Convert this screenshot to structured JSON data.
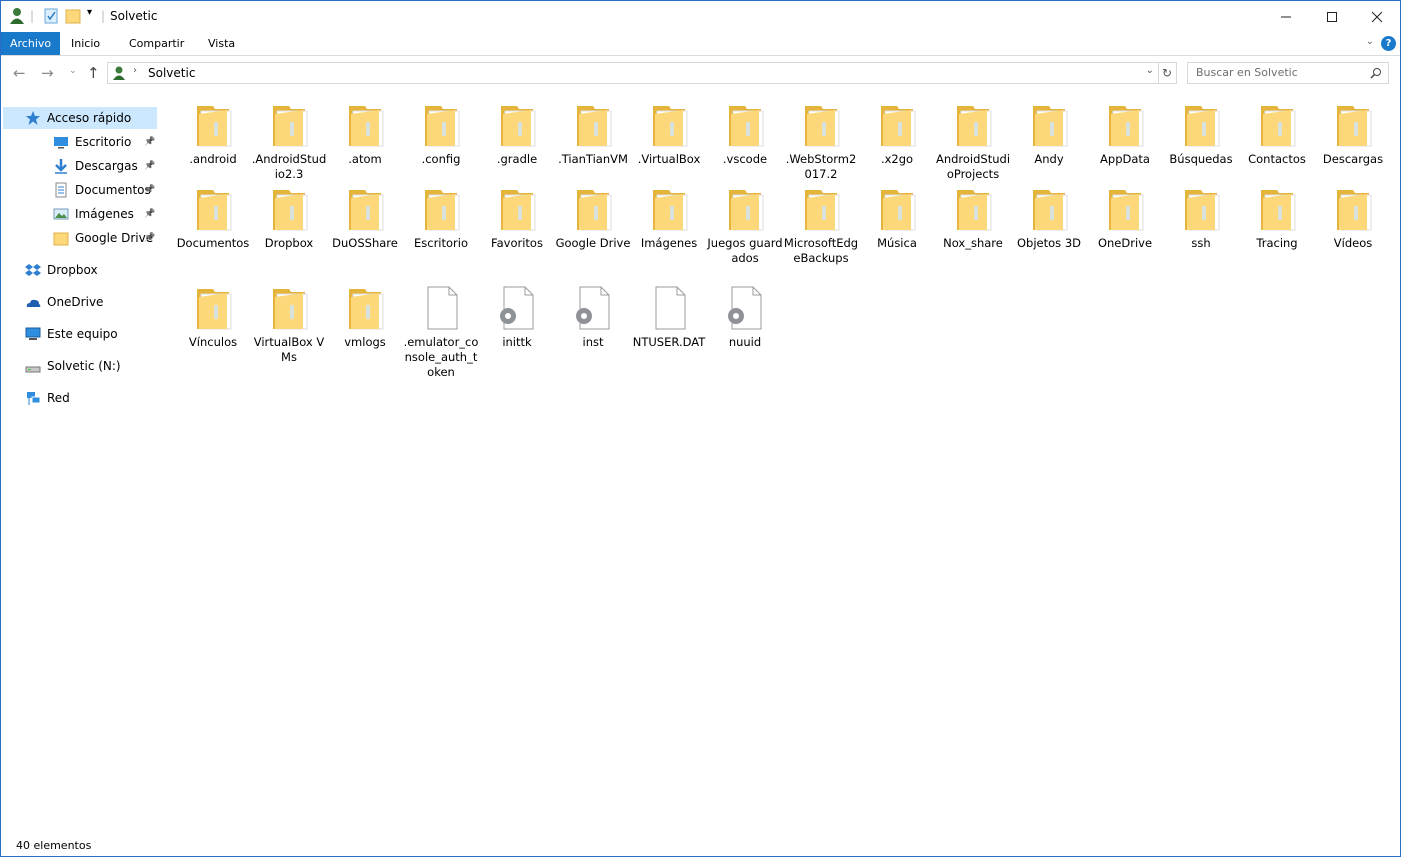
{
  "window": {
    "title": "Solvetic",
    "minimize_icon": "minimize-icon",
    "maximize_icon": "maximize-icon",
    "close_icon": "close-icon"
  },
  "ribbon": {
    "tabs": [
      "Archivo",
      "Inicio",
      "Compartir",
      "Vista"
    ],
    "active_tab": "Archivo",
    "help_label": "?"
  },
  "navigation": {
    "path": [
      "Solvetic"
    ],
    "search_placeholder": "Buscar en Solvetic"
  },
  "sidebar": {
    "items": [
      {
        "label": "Acceso rápido",
        "icon": "star-icon",
        "selected": true,
        "pinned": false
      },
      {
        "label": "Escritorio",
        "icon": "desktop-icon",
        "pinned": true
      },
      {
        "label": "Descargas",
        "icon": "download-icon",
        "pinned": true
      },
      {
        "label": "Documentos",
        "icon": "document-icon",
        "pinned": true
      },
      {
        "label": "Imágenes",
        "icon": "pictures-icon",
        "pinned": true
      },
      {
        "label": "Google Drive",
        "icon": "folder-icon",
        "pinned": true
      },
      {
        "label": "Dropbox",
        "icon": "dropbox-icon"
      },
      {
        "label": "OneDrive",
        "icon": "onedrive-icon"
      },
      {
        "label": "Este equipo",
        "icon": "computer-icon"
      },
      {
        "label": "Solvetic (N:)",
        "icon": "drive-icon"
      },
      {
        "label": "Red",
        "icon": "network-icon"
      }
    ]
  },
  "files": [
    {
      "name": ".android",
      "type": "folder"
    },
    {
      "name": ".AndroidStudio2.3",
      "type": "folder"
    },
    {
      "name": ".atom",
      "type": "folder"
    },
    {
      "name": ".config",
      "type": "folder"
    },
    {
      "name": ".gradle",
      "type": "folder"
    },
    {
      "name": ".TianTianVM",
      "type": "folder"
    },
    {
      "name": ".VirtualBox",
      "type": "folder"
    },
    {
      "name": ".vscode",
      "type": "folder"
    },
    {
      "name": ".WebStorm2017.2",
      "type": "folder"
    },
    {
      "name": ".x2go",
      "type": "folder"
    },
    {
      "name": "AndroidStudioProjects",
      "type": "folder"
    },
    {
      "name": "Andy",
      "type": "folder"
    },
    {
      "name": "AppData",
      "type": "folder"
    },
    {
      "name": "Búsquedas",
      "type": "folder"
    },
    {
      "name": "Contactos",
      "type": "folder"
    },
    {
      "name": "Descargas",
      "type": "folder"
    },
    {
      "name": "Documentos",
      "type": "folder"
    },
    {
      "name": "Dropbox",
      "type": "folder"
    },
    {
      "name": "DuOSShare",
      "type": "folder"
    },
    {
      "name": "Escritorio",
      "type": "folder"
    },
    {
      "name": "Favoritos",
      "type": "folder"
    },
    {
      "name": "Google Drive",
      "type": "folder"
    },
    {
      "name": "Imágenes",
      "type": "folder"
    },
    {
      "name": "Juegos guardados",
      "type": "folder"
    },
    {
      "name": "MicrosoftEdgeBackups",
      "type": "folder"
    },
    {
      "name": "Música",
      "type": "folder"
    },
    {
      "name": "Nox_share",
      "type": "folder"
    },
    {
      "name": "Objetos 3D",
      "type": "folder"
    },
    {
      "name": "OneDrive",
      "type": "folder"
    },
    {
      "name": "ssh",
      "type": "folder"
    },
    {
      "name": "Tracing",
      "type": "folder"
    },
    {
      "name": "Vídeos",
      "type": "folder"
    },
    {
      "name": "Vínculos",
      "type": "folder"
    },
    {
      "name": "VirtualBox VMs",
      "type": "folder"
    },
    {
      "name": "vmlogs",
      "type": "folder"
    },
    {
      "name": ".emulator_console_auth_token",
      "type": "file"
    },
    {
      "name": "inittk",
      "type": "settings-file"
    },
    {
      "name": "inst",
      "type": "settings-file"
    },
    {
      "name": "NTUSER.DAT",
      "type": "file"
    },
    {
      "name": "nuuid",
      "type": "settings-file"
    }
  ],
  "status": {
    "count_label": "40 elementos"
  },
  "colors": {
    "accent": "#1979ca",
    "selection": "#cce8ff",
    "folder": "#fcd87a"
  }
}
